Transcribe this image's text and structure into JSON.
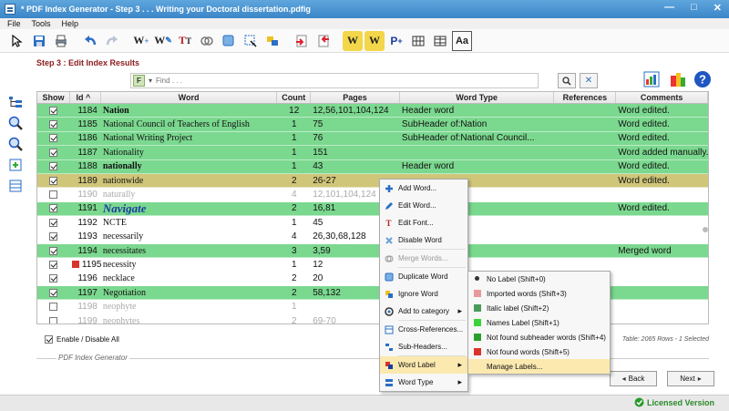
{
  "window": {
    "title": "* PDF Index Generator - Step 3 . . . Writing your Doctoral dissertation.pdfig",
    "controls": [
      "—",
      "□",
      "✕"
    ]
  },
  "menubar": [
    "File",
    "Tools",
    "Help"
  ],
  "step_title": "Step 3 : Edit Index Results",
  "search": {
    "placeholder": "Find . . .",
    "filter_label": "F"
  },
  "table": {
    "headers": [
      "Show",
      "Id ^",
      "Word",
      "Count",
      "Pages",
      "Word Type",
      "References",
      "Comments"
    ],
    "rows": [
      {
        "id": "1184",
        "word": "Nation",
        "count": "12",
        "pages": "12,56,101,104,124",
        "type": "Header word",
        "refs": "",
        "comments": "Word edited.",
        "bg": "g",
        "checked": true,
        "style": "bold"
      },
      {
        "id": "1185",
        "word": "National Council of Teachers of English",
        "count": "1",
        "pages": "75",
        "type": "SubHeader of:Nation",
        "refs": "",
        "comments": "Word edited.",
        "bg": "g",
        "checked": true,
        "style": ""
      },
      {
        "id": "1186",
        "word": "National Writing Project",
        "count": "1",
        "pages": "76",
        "type": "SubHeader of:National Council...",
        "refs": "",
        "comments": "Word edited.",
        "bg": "g",
        "checked": true,
        "style": ""
      },
      {
        "id": "1187",
        "word": "Nationality",
        "count": "1",
        "pages": "151",
        "type": "",
        "refs": "",
        "comments": "Word added manually.",
        "bg": "g",
        "checked": true,
        "style": ""
      },
      {
        "id": "1188",
        "word": "nationally",
        "count": "1",
        "pages": "43",
        "type": "Header word",
        "refs": "",
        "comments": "Word edited.",
        "bg": "g",
        "checked": true,
        "style": "bold"
      },
      {
        "id": "1189",
        "word": "nationwide",
        "count": "2",
        "pages": "26-27",
        "type": "",
        "refs": "",
        "comments": "Word edited.",
        "bg": "y",
        "checked": true,
        "style": ""
      },
      {
        "id": "1190",
        "word": "naturally",
        "count": "4",
        "pages": "12,101,104,124",
        "type": "",
        "refs": "",
        "comments": "",
        "bg": "dis",
        "checked": false,
        "style": ""
      },
      {
        "id": "1191",
        "word": "Navigate",
        "count": "2",
        "pages": "16,81",
        "type": "",
        "refs": "",
        "comments": "Word edited.",
        "bg": "g",
        "checked": true,
        "style": "big"
      },
      {
        "id": "1192",
        "word": "NCTE",
        "count": "1",
        "pages": "45",
        "type": "",
        "refs": "",
        "comments": "",
        "bg": "",
        "checked": true,
        "style": ""
      },
      {
        "id": "1193",
        "word": "necessarily",
        "count": "4",
        "pages": "26,30,68,128",
        "type": "",
        "refs": "",
        "comments": "",
        "bg": "",
        "checked": true,
        "style": ""
      },
      {
        "id": "1194",
        "word": "necessitates",
        "count": "3",
        "pages": "3,59",
        "type": "",
        "refs": "",
        "comments": "Merged word",
        "bg": "g",
        "checked": true,
        "style": ""
      },
      {
        "id": "1195",
        "word": "necessity",
        "count": "1",
        "pages": "12",
        "type": "",
        "refs": "",
        "comments": "",
        "bg": "",
        "checked": true,
        "style": "",
        "marker": "#d9342b"
      },
      {
        "id": "1196",
        "word": "necklace",
        "count": "2",
        "pages": "20",
        "type": "",
        "refs": "",
        "comments": "",
        "bg": "",
        "checked": true,
        "style": ""
      },
      {
        "id": "1197",
        "word": "Negotiation",
        "count": "2",
        "pages": "58,132",
        "type": "",
        "refs": "",
        "comments": "",
        "bg": "g",
        "checked": true,
        "style": ""
      },
      {
        "id": "1198",
        "word": "neophyte",
        "count": "1",
        "pages": "",
        "type": "",
        "refs": "",
        "comments": "",
        "bg": "dis",
        "checked": false,
        "style": ""
      },
      {
        "id": "1199",
        "word": "neophytes",
        "count": "2",
        "pages": "69-70",
        "type": "",
        "refs": "",
        "comments": "",
        "bg": "dis",
        "checked": false,
        "style": ""
      }
    ]
  },
  "enable_label": "Enable / Disable All",
  "table_info": "Table: 2065 Rows - 1 Selected",
  "footer_label": "PDF Index Generator",
  "back_label": "Back",
  "next_label": "Next",
  "license_label": "Licensed Version",
  "context_menu": [
    {
      "label": "Add Word...",
      "icon": "plus-icon",
      "disabled": false
    },
    {
      "label": "Edit Word...",
      "icon": "pencil-icon",
      "disabled": false
    },
    {
      "label": "Edit Font...",
      "icon": "font-icon",
      "disabled": false
    },
    {
      "label": "Disable Word",
      "icon": "x-icon",
      "disabled": false
    },
    {
      "label": "Merge Words...",
      "icon": "merge-icon",
      "disabled": true
    },
    {
      "label": "Duplicate Word",
      "icon": "duplicate-icon",
      "disabled": false
    },
    {
      "label": "Ignore Word",
      "icon": "ignore-icon",
      "disabled": false
    },
    {
      "label": "Add to category",
      "icon": "category-icon",
      "disabled": false
    },
    {
      "label": "Cross-References...",
      "icon": "crossref-icon",
      "disabled": false
    },
    {
      "label": "Sub-Headers...",
      "icon": "subheader-icon",
      "disabled": false
    },
    {
      "label": "Word Label",
      "icon": "label-icon",
      "disabled": false
    },
    {
      "label": "Word Type",
      "icon": "type-icon",
      "disabled": false
    }
  ],
  "submenu": [
    {
      "label": "No Label (Shift+0)",
      "color": "",
      "selected": true
    },
    {
      "label": "Imported words (Shift+3)",
      "color": "#e89a9a"
    },
    {
      "label": "Italic label (Shift+2)",
      "color": "#4a9a5a"
    },
    {
      "label": "Names Label (Shift+1)",
      "color": "#3ad43a"
    },
    {
      "label": "Not found subheader words (Shift+4)",
      "color": "#2aa02a"
    },
    {
      "label": "Not found words (Shift+5)",
      "color": "#d9342b"
    },
    {
      "label": "Manage Labels...",
      "color": ""
    }
  ]
}
